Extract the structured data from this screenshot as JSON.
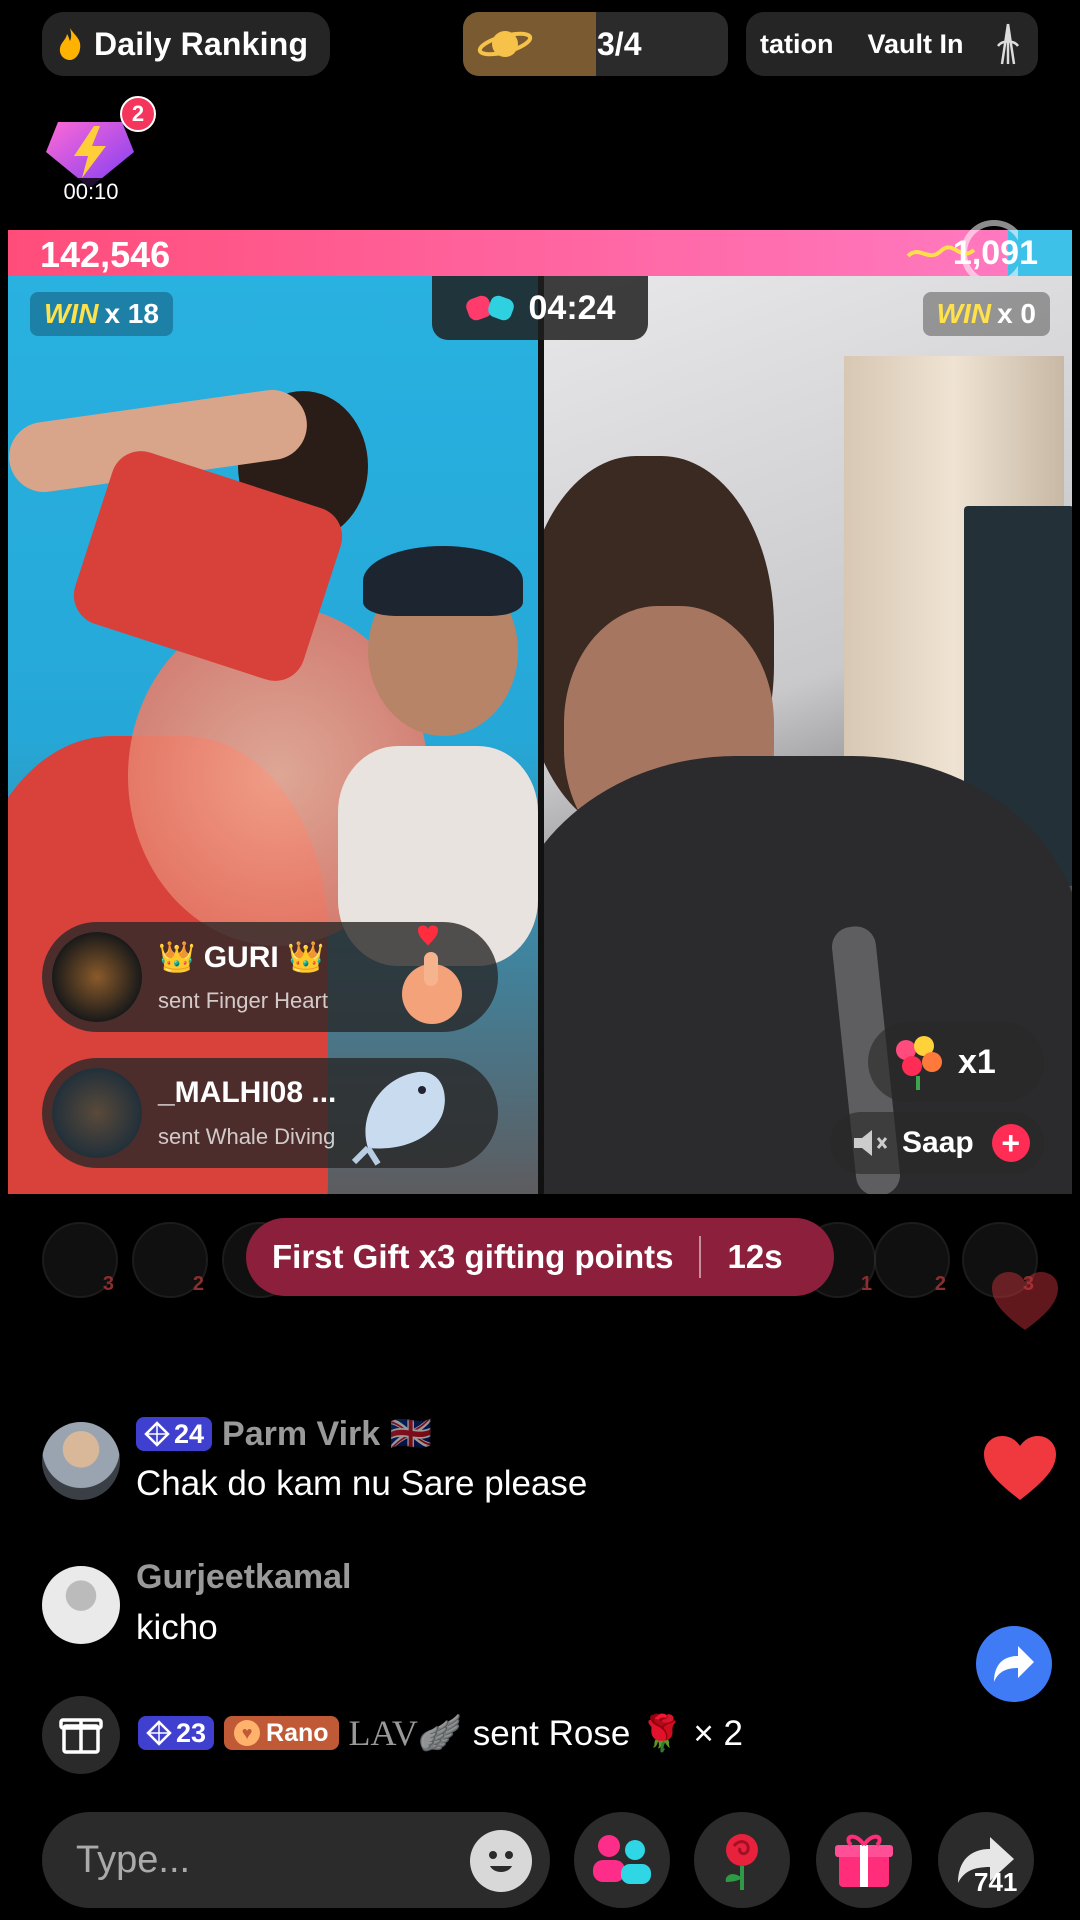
{
  "top_bar": {
    "ranking_label": "Daily Ranking",
    "progress_count": "3/4",
    "progress_fraction": 0.5,
    "vault_text_1": "tation",
    "vault_text_2": "Vault In"
  },
  "badge": {
    "notification_count": "2",
    "timer": "00:10"
  },
  "battle": {
    "left_score": "142,546",
    "right_score": "1,091",
    "left_share": 0.94,
    "timer": "04:24",
    "left_win_label": "WIN",
    "left_win_count": "x 18",
    "right_win_label": "WIN",
    "right_win_count": "x 0"
  },
  "gift_notifications": [
    {
      "name": "👑 GURI 👑",
      "action": "sent Finger Heart"
    },
    {
      "name": "_MALHI08 ...",
      "action": "sent Whale Diving"
    }
  ],
  "right_gift": {
    "count": "x1"
  },
  "guest": {
    "name": "Saap",
    "plus": "+"
  },
  "first_gift": {
    "message": "First Gift x3 gifting points",
    "seconds": "12s"
  },
  "supporters": {
    "left_ranks": [
      "3",
      "2",
      "1"
    ],
    "right_ranks": [
      "1",
      "2",
      "3"
    ]
  },
  "comments": [
    {
      "level": "24",
      "user": "Parm Virk 🇬🇧",
      "text": "Chak do kam nu Sare please"
    },
    {
      "user": "Gurjeetkamal",
      "text": "kicho"
    }
  ],
  "gift_message": {
    "level": "23",
    "fan_badge": "Rano",
    "user": "LAV🪽",
    "text": "sent Rose 🌹 × 2"
  },
  "input": {
    "placeholder": "Type..."
  },
  "share": {
    "count": "741"
  },
  "colors": {
    "pink_bar": "#ff4d7a",
    "blue_bar": "#3ec1e8",
    "banner": "#8c1f3c",
    "level_badge": "#3f3fd0",
    "share_blue": "#3e7bf5"
  }
}
